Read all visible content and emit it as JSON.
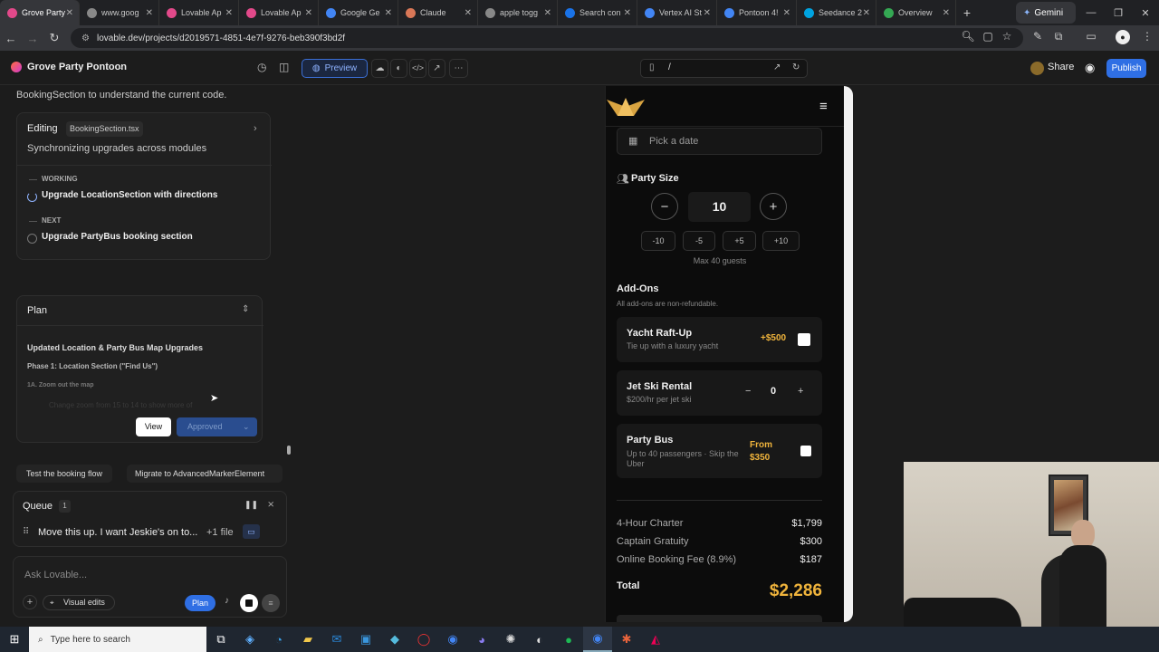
{
  "browser": {
    "tabs": [
      {
        "label": "Grove Party",
        "color": "#e2498a"
      },
      {
        "label": "www.goog",
        "color": "#888888"
      },
      {
        "label": "Lovable Ap",
        "color": "#e2498a"
      },
      {
        "label": "Lovable Ap",
        "color": "#e2498a"
      },
      {
        "label": "Google Ge",
        "color": "#4285f4"
      },
      {
        "label": "Claude",
        "color": "#d97757"
      },
      {
        "label": "apple togg",
        "color": "#888888"
      },
      {
        "label": "Search con",
        "color": "#1a73e8"
      },
      {
        "label": "Vertex AI St",
        "color": "#4285f4"
      },
      {
        "label": "Pontoon 4!",
        "color": "#4285f4"
      },
      {
        "label": "Seedance 2",
        "color": "#00a3e0"
      },
      {
        "label": "Overview",
        "color": "#34a853"
      }
    ],
    "gemini_label": "Gemini",
    "url": "lovable.dev/projects/d2019571-4851-4e7f-9276-beb390f3bd2f"
  },
  "appbar": {
    "project_name": "Grove Party Pontoon",
    "preview_label": "Preview",
    "path": "/",
    "share_label": "Share",
    "publish_label": "Publish"
  },
  "chat": {
    "intro_text": "BookingSection to understand the current code.",
    "editing_label": "Editing",
    "editing_file": "BookingSection.tsx",
    "editing_status": "Synchronizing upgrades across modules",
    "working_label": "WORKING",
    "working_task": "Upgrade LocationSection with directions",
    "next_label": "NEXT",
    "next_task": "Upgrade PartyBus booking section",
    "plan": {
      "title": "Plan",
      "heading": "Updated Location & Party Bus Map Upgrades",
      "phase": "Phase 1: Location Section (\"Find Us\")",
      "step": "1A. Zoom out the map",
      "faded": "Change zoom from 15 to 14 to show more of",
      "view_label": "View",
      "approved_label": "Approved"
    },
    "suggestions": [
      "Test the booking flow",
      "Migrate to AdvancedMarkerElement"
    ],
    "queue": {
      "label": "Queue",
      "count": "1",
      "item": "Move this up. I want Jeskie's on to...",
      "item_meta": "+1 file"
    },
    "input_placeholder": "Ask Lovable...",
    "visual_edits_label": "Visual edits",
    "plan_button_label": "Plan"
  },
  "site": {
    "date_placeholder": "Pick a date",
    "party_size_label": "Party Size",
    "party_size_value": "10",
    "size_chips": [
      "-10",
      "-5",
      "+5",
      "+10"
    ],
    "max_guests": "Max 40 guests",
    "addons_title": "Add-Ons",
    "addons_note": "All add-ons are non-refundable.",
    "addons": [
      {
        "name": "Yacht Raft-Up",
        "desc": "Tie up with a luxury yacht",
        "price": "+$500"
      },
      {
        "name": "Jet Ski Rental",
        "desc": "$200/hr per jet ski",
        "qty": "0"
      },
      {
        "name": "Party Bus",
        "desc": "Up to 40 passengers · Skip the Uber",
        "price": "From $350"
      }
    ],
    "summary": [
      {
        "label": "4-Hour Charter",
        "value": "$1,799"
      },
      {
        "label": "Captain Gratuity",
        "value": "$300"
      },
      {
        "label": "Online Booking Fee (8.9%)",
        "value": "$187"
      }
    ],
    "total_label": "Total",
    "total_value": "$2,286",
    "accent": "#f0b43c"
  },
  "taskbar": {
    "search_placeholder": "Type here to search"
  }
}
